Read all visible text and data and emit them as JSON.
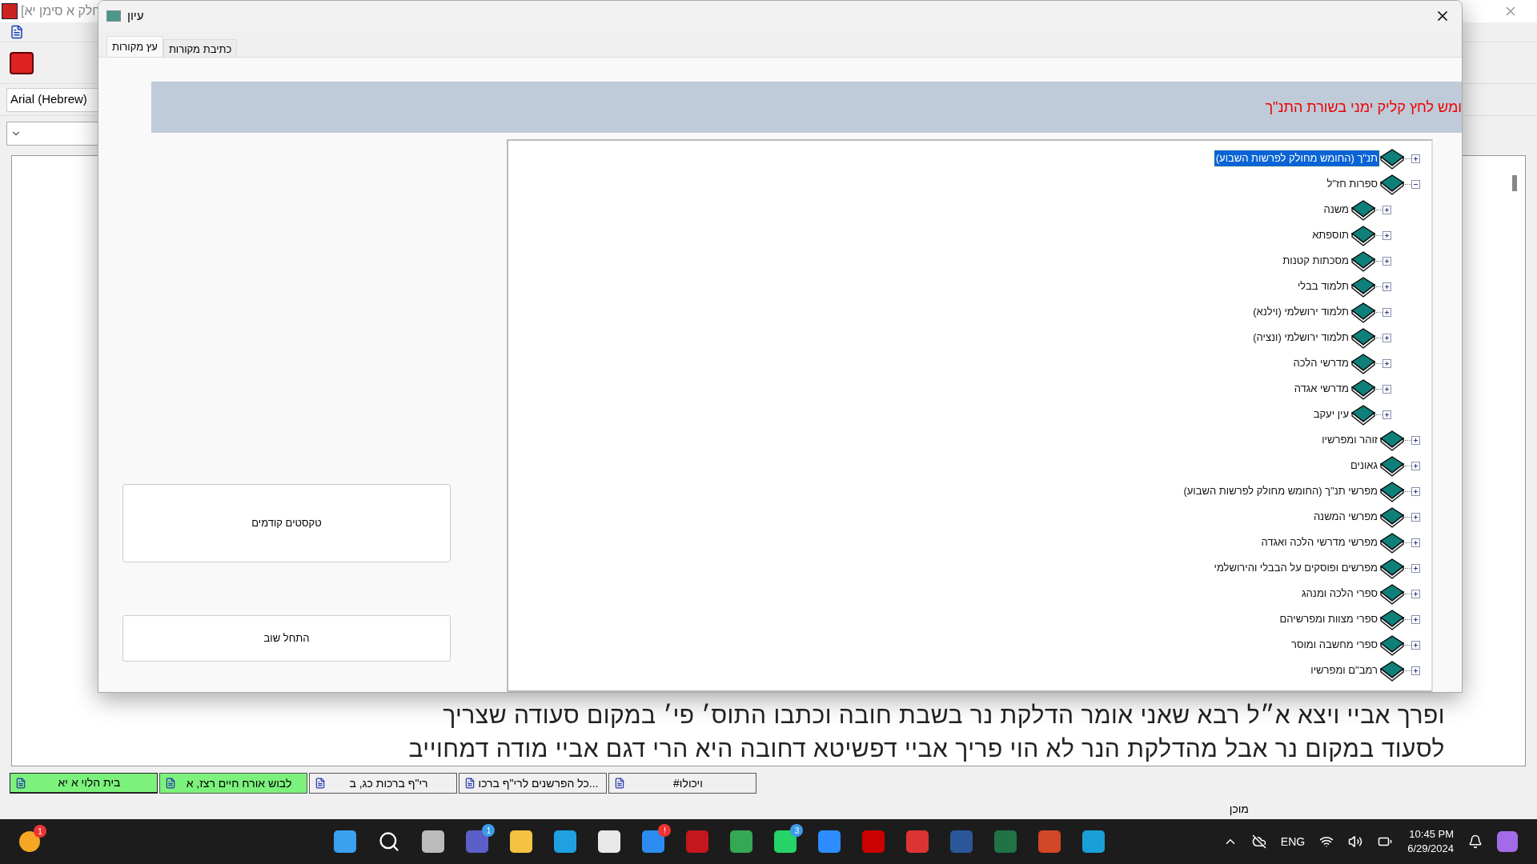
{
  "main_window": {
    "title": "חלק א סימן יא]",
    "font_box": {
      "value": "Arial (Hebrew)"
    },
    "document_lines": [
      "ופרך אביי ויצא א״ל רבא שאני אומר הדלקת נר בשבת חובה וכתבו התוס׳ פי׳ במקום סעודה שצריך",
      "לסעוד במקום נר אבל מהדלקת הנר לא הוי פריך אביי דפשיטא דחובה היא הרי דגם אביי מודה דמחוייב"
    ],
    "doc_tabs": [
      {
        "label": "ויכולו#",
        "color": "#f0f0f0",
        "selected": false
      },
      {
        "label": "...כל הפרשנים לרי\"ף ברכו",
        "color": "#f0f0f0",
        "selected": false
      },
      {
        "label": "רי\"ף ברכות כג, ב",
        "color": "#f0f0f0",
        "selected": false
      },
      {
        "label": "לבוש אורח חיים רצז, א",
        "color": "#7cf27c",
        "selected": false
      },
      {
        "label": "בית הלוי א יא",
        "color": "#7cf27c",
        "selected": true
      }
    ],
    "status_bar": {
      "text": "מוכן"
    }
  },
  "dialog": {
    "title": "עיון",
    "tabs": [
      {
        "label": "כתיבת מקורות",
        "selected": false
      },
      {
        "label": "עץ מקורות",
        "selected": true
      }
    ],
    "banner": "ומש לחץ קליק ימני בשורת התנ\"ך",
    "buttons": [
      "טקסטים קודמים",
      "התחל שוב"
    ],
    "tree": [
      {
        "label": "תנ\"ך (החומש מחולק לפרשות השבוע)",
        "selected": true,
        "expanded": false
      },
      {
        "label": "ספרות חז\"ל",
        "selected": false,
        "expanded": true,
        "children": [
          {
            "label": "משנה",
            "selected": false,
            "expanded": false
          },
          {
            "label": "תוספתא",
            "selected": false,
            "expanded": false
          },
          {
            "label": "מסכתות קטנות",
            "selected": false,
            "expanded": false
          },
          {
            "label": "תלמוד בבלי",
            "selected": false,
            "expanded": false
          },
          {
            "label": "תלמוד ירושלמי (וילנא)",
            "selected": false,
            "expanded": false
          },
          {
            "label": "תלמוד ירושלמי (ונציה)",
            "selected": false,
            "expanded": false
          },
          {
            "label": "מדרשי הלכה",
            "selected": false,
            "expanded": false
          },
          {
            "label": "מדרשי אגדה",
            "selected": false,
            "expanded": false
          },
          {
            "label": "עין יעקב",
            "selected": false,
            "expanded": false
          }
        ]
      },
      {
        "label": "זוהר ומפרשיו",
        "selected": false,
        "expanded": false
      },
      {
        "label": "גאונים",
        "selected": false,
        "expanded": false
      },
      {
        "label": "מפרשי תנ\"ך (החומש מחולק לפרשות השבוע)",
        "selected": false,
        "expanded": false
      },
      {
        "label": "מפרשי המשנה",
        "selected": false,
        "expanded": false
      },
      {
        "label": "מפרשי מדרשי הלכה ואגדה",
        "selected": false,
        "expanded": false
      },
      {
        "label": "מפרשים ופוסקים על הבבלי והירושלמי",
        "selected": false,
        "expanded": false
      },
      {
        "label": "ספרי הלכה ומנהג",
        "selected": false,
        "expanded": false
      },
      {
        "label": "ספרי מצוות ומפרשיהם",
        "selected": false,
        "expanded": false
      },
      {
        "label": "ספרי מחשבה ומוסר",
        "selected": false,
        "expanded": false
      },
      {
        "label": "רמב\"ם ומפרשיו",
        "selected": false,
        "expanded": false
      }
    ]
  },
  "taskbar": {
    "weather_badge": "1",
    "teams_badge": "1",
    "whatsapp_badge": "3",
    "help_badge": "!",
    "language": "ENG",
    "time": "10:45 PM",
    "date": "6/29/2024"
  }
}
